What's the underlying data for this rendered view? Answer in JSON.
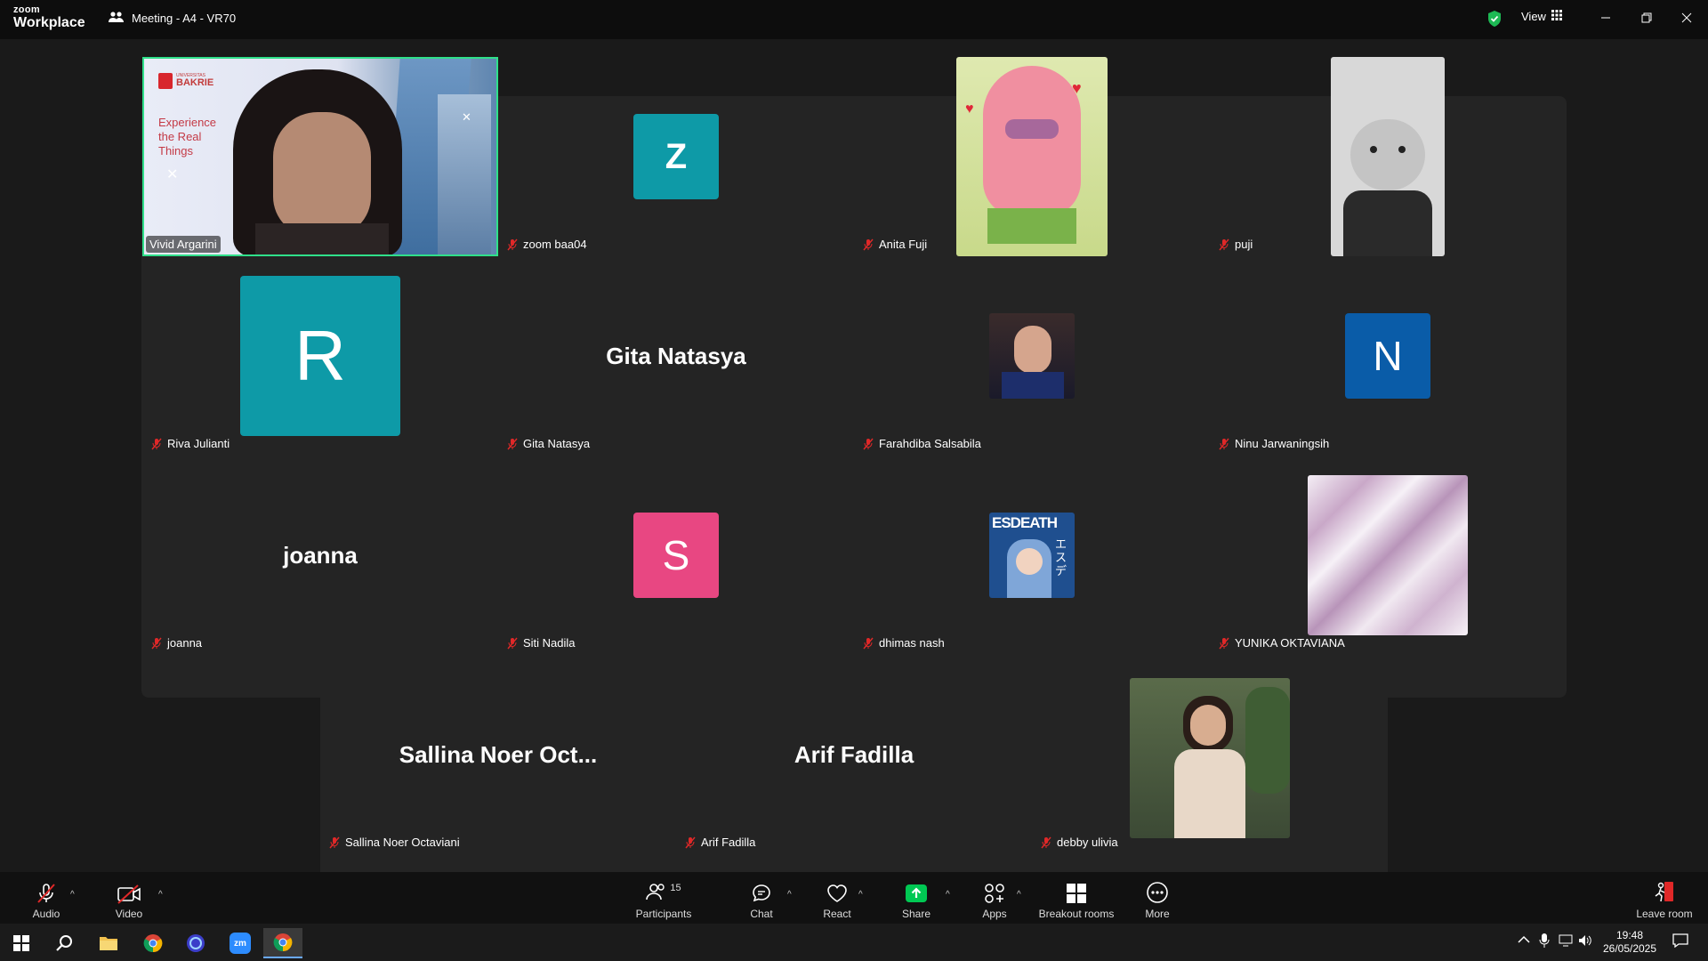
{
  "app": {
    "brand_line1": "zoom",
    "brand_line2": "Workplace",
    "meeting_title": "Meeting - A4 - VR70",
    "view_label": "View"
  },
  "tiles": [
    {
      "name": "Vivid Argarini",
      "kind": "video"
    },
    {
      "name": "zoom baa04",
      "kind": "letter",
      "letter": "Z",
      "color": "#0e9aa7"
    },
    {
      "name": "Anita Fuji",
      "kind": "image"
    },
    {
      "name": "puji",
      "kind": "image"
    },
    {
      "name": "Riva Julianti",
      "kind": "letter",
      "letter": "R",
      "color": "#0e9aa7"
    },
    {
      "name": "Gita Natasya",
      "kind": "text",
      "display": "Gita Natasya"
    },
    {
      "name": "Farahdiba Salsabila",
      "kind": "image"
    },
    {
      "name": "Ninu Jarwaningsih",
      "kind": "letter",
      "letter": "N",
      "color": "#0a5ca8"
    },
    {
      "name": "joanna",
      "kind": "text",
      "display": "joanna"
    },
    {
      "name": "Siti Nadila",
      "kind": "letter",
      "letter": "S",
      "color": "#e84782"
    },
    {
      "name": "dhimas nash",
      "kind": "image"
    },
    {
      "name": "YUNIKA OKTAVIANA",
      "kind": "image"
    },
    {
      "name": "Sallina Noer Octaviani",
      "kind": "text",
      "display": "Sallina Noer Oct..."
    },
    {
      "name": "Arif Fadilla",
      "kind": "text",
      "display": "Arif Fadilla"
    },
    {
      "name": "debby ulivia",
      "kind": "image"
    }
  ],
  "video_slide": {
    "logo": "BAKRIE",
    "logo_small": "UNIVERSITAS",
    "text1": "Experience",
    "text2": "the Real",
    "text3": "Things"
  },
  "esdeath_text": "ESDEATH",
  "esdeath_kana": "エスデ",
  "toolbar": {
    "audio": "Audio",
    "video": "Video",
    "participants": "Participants",
    "participants_count": "15",
    "chat": "Chat",
    "react": "React",
    "share": "Share",
    "apps": "Apps",
    "breakout": "Breakout rooms",
    "more": "More",
    "leave": "Leave room"
  },
  "taskbar": {
    "time": "19:48",
    "date": "26/05/2025"
  },
  "colors": {
    "active_speaker_border": "#2fe08a",
    "share_green": "#00c853",
    "leave_red": "#e02828",
    "mic_muted_red": "#e02828"
  }
}
